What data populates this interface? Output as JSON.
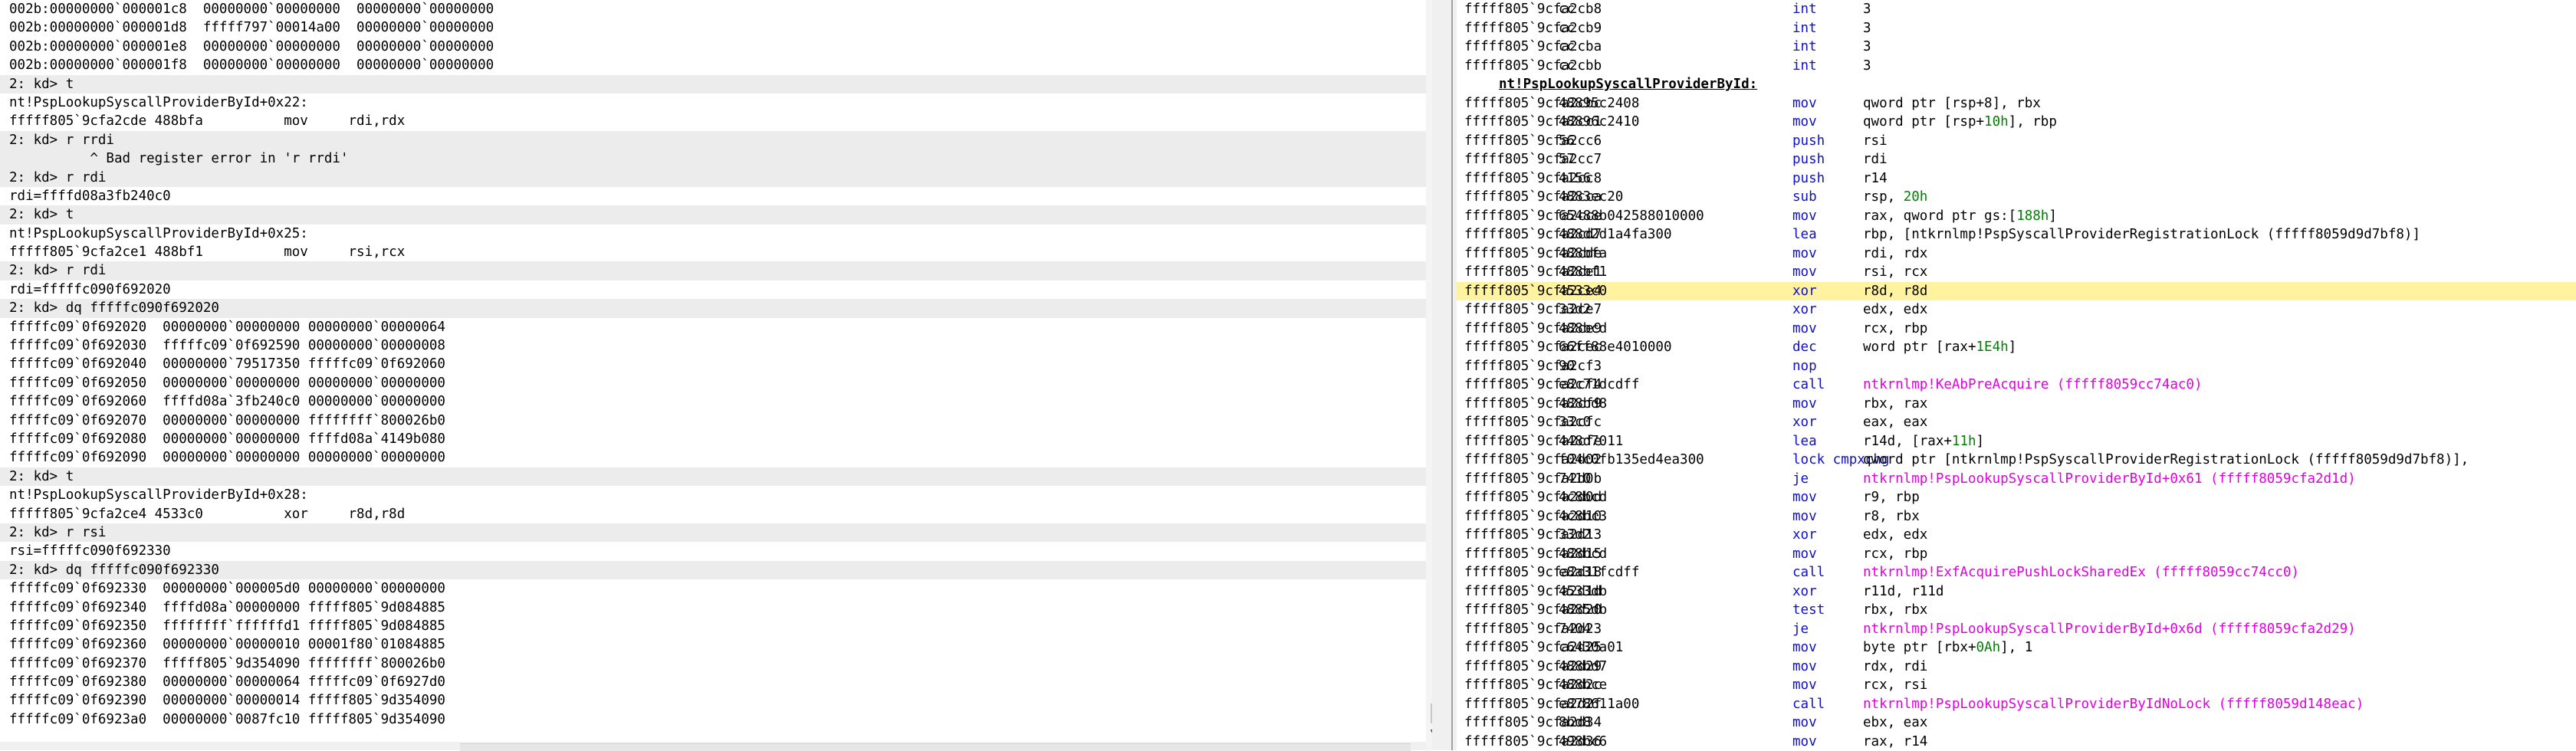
{
  "command_window": {
    "lines": [
      {
        "t": "002b:00000000`000001c8  00000000`00000000  00000000`00000000",
        "p": false
      },
      {
        "t": "002b:00000000`000001d8  fffff797`00014a00  00000000`00000000",
        "p": false
      },
      {
        "t": "002b:00000000`000001e8  00000000`00000000  00000000`00000000",
        "p": false
      },
      {
        "t": "002b:00000000`000001f8  00000000`00000000  00000000`00000000",
        "p": false
      },
      {
        "t": "2: kd> t",
        "p": true
      },
      {
        "t": "nt!PspLookupSyscallProviderById+0x22:",
        "p": false
      },
      {
        "t": "fffff805`9cfa2cde 488bfa          mov     rdi,rdx",
        "p": false
      },
      {
        "t": "2: kd> r rrdi",
        "p": true
      },
      {
        "t": "          ^ Bad register error in 'r rrdi'",
        "p": true
      },
      {
        "t": "2: kd> r rdi",
        "p": true
      },
      {
        "t": "rdi=ffffd08a3fb240c0",
        "p": false
      },
      {
        "t": "2: kd> t",
        "p": true
      },
      {
        "t": "nt!PspLookupSyscallProviderById+0x25:",
        "p": false
      },
      {
        "t": "fffff805`9cfa2ce1 488bf1          mov     rsi,rcx",
        "p": false
      },
      {
        "t": "2: kd> r rdi",
        "p": true
      },
      {
        "t": "rdi=fffffc090f692020",
        "p": false
      },
      {
        "t": "2: kd> dq fffffc090f692020",
        "p": true
      },
      {
        "t": "fffffc09`0f692020  00000000`00000000 00000000`00000064",
        "p": false
      },
      {
        "t": "fffffc09`0f692030  fffffc09`0f692590 00000000`00000008",
        "p": false
      },
      {
        "t": "fffffc09`0f692040  00000000`79517350 fffffc09`0f692060",
        "p": false
      },
      {
        "t": "fffffc09`0f692050  00000000`00000000 00000000`00000000",
        "p": false
      },
      {
        "t": "fffffc09`0f692060  ffffd08a`3fb240c0 00000000`00000000",
        "p": false
      },
      {
        "t": "fffffc09`0f692070  00000000`00000000 ffffffff`800026b0",
        "p": false
      },
      {
        "t": "fffffc09`0f692080  00000000`00000000 ffffd08a`4149b080",
        "p": false
      },
      {
        "t": "fffffc09`0f692090  00000000`00000000 00000000`00000000",
        "p": false
      },
      {
        "t": "2: kd> t",
        "p": true
      },
      {
        "t": "nt!PspLookupSyscallProviderById+0x28:",
        "p": false
      },
      {
        "t": "fffff805`9cfa2ce4 4533c0          xor     r8d,r8d",
        "p": false
      },
      {
        "t": "2: kd> r rsi",
        "p": true
      },
      {
        "t": "rsi=fffffc090f692330",
        "p": false
      },
      {
        "t": "2: kd> dq fffffc090f692330",
        "p": true
      },
      {
        "t": "fffffc09`0f692330  00000000`000005d0 00000000`00000000",
        "p": false
      },
      {
        "t": "fffffc09`0f692340  ffffd08a`00000000 fffff805`9d084885",
        "p": false
      },
      {
        "t": "fffffc09`0f692350  ffffffff`ffffffd1 fffff805`9d084885",
        "p": false
      },
      {
        "t": "fffffc09`0f692360  00000000`00000010 00001f80`01084885",
        "p": false
      },
      {
        "t": "fffffc09`0f692370  fffff805`9d354090 ffffffff`800026b0",
        "p": false
      },
      {
        "t": "fffffc09`0f692380  00000000`00000064 fffffc09`0f6927d0",
        "p": false
      },
      {
        "t": "fffffc09`0f692390  00000000`00000014 fffff805`9d354090",
        "p": false
      },
      {
        "t": "fffffc09`0f6923a0  00000000`0087fc10 fffff805`9d354090",
        "p": false
      }
    ]
  },
  "disassembly": {
    "rows": [
      {
        "addr": "fffff805`9cfa2cb8",
        "bytes": "cc",
        "mn": "int",
        "ops": [
          [
            "3",
            "n"
          ]
        ]
      },
      {
        "addr": "fffff805`9cfa2cb9",
        "bytes": "cc",
        "mn": "int",
        "ops": [
          [
            "3",
            "n"
          ]
        ]
      },
      {
        "addr": "fffff805`9cfa2cba",
        "bytes": "cc",
        "mn": "int",
        "ops": [
          [
            "3",
            "n"
          ]
        ]
      },
      {
        "addr": "fffff805`9cfa2cbb",
        "bytes": "cc",
        "mn": "int",
        "ops": [
          [
            "3",
            "n"
          ]
        ]
      },
      {
        "symbol": "nt!PspLookupSyscallProviderById:"
      },
      {
        "addr": "fffff805`9cfa2cbc",
        "bytes": "48895c2408",
        "mn": "mov",
        "ops": [
          [
            "qword ptr [rsp+8], rbx",
            "n"
          ]
        ]
      },
      {
        "addr": "fffff805`9cfa2cc1",
        "bytes": "48896c2410",
        "mn": "mov",
        "ops": [
          [
            "qword ptr [rsp+",
            "n"
          ],
          [
            "10h",
            "g"
          ],
          [
            "], rbp",
            "n"
          ]
        ]
      },
      {
        "addr": "fffff805`9cfa2cc6",
        "bytes": "56",
        "mn": "push",
        "ops": [
          [
            "rsi",
            "n"
          ]
        ]
      },
      {
        "addr": "fffff805`9cfa2cc7",
        "bytes": "57",
        "mn": "push",
        "ops": [
          [
            "rdi",
            "n"
          ]
        ]
      },
      {
        "addr": "fffff805`9cfa2cc8",
        "bytes": "4156",
        "mn": "push",
        "ops": [
          [
            "r14",
            "n"
          ]
        ]
      },
      {
        "addr": "fffff805`9cfa2cca",
        "bytes": "4883ec20",
        "mn": "sub",
        "ops": [
          [
            "rsp, ",
            "n"
          ],
          [
            "20h",
            "g"
          ]
        ]
      },
      {
        "addr": "fffff805`9cfa2cce",
        "bytes": "65488b042588010000",
        "mn": "mov",
        "ops": [
          [
            "rax, qword ptr gs:[",
            "n"
          ],
          [
            "188h",
            "g"
          ],
          [
            "]",
            "n"
          ]
        ]
      },
      {
        "addr": "fffff805`9cfa2cd7",
        "bytes": "488d2d1a4fa300",
        "mn": "lea",
        "ops": [
          [
            "rbp, [ntkrnlmp!PspSyscallProviderRegistrationLock (fffff8059d9d7bf8)]",
            "n"
          ]
        ]
      },
      {
        "addr": "fffff805`9cfa2cde",
        "bytes": "488bfa",
        "mn": "mov",
        "ops": [
          [
            "rdi, rdx",
            "n"
          ]
        ]
      },
      {
        "addr": "fffff805`9cfa2ce1",
        "bytes": "488bf1",
        "mn": "mov",
        "ops": [
          [
            "rsi, rcx",
            "n"
          ]
        ]
      },
      {
        "addr": "fffff805`9cfa2ce4",
        "bytes": "4533c0",
        "mn": "xor",
        "ops": [
          [
            "r8d, r8d",
            "n"
          ]
        ],
        "hl": true
      },
      {
        "addr": "fffff805`9cfa2ce7",
        "bytes": "33d2",
        "mn": "xor",
        "ops": [
          [
            "edx, edx",
            "n"
          ]
        ]
      },
      {
        "addr": "fffff805`9cfa2ce9",
        "bytes": "488bcd",
        "mn": "mov",
        "ops": [
          [
            "rcx, rbp",
            "n"
          ]
        ]
      },
      {
        "addr": "fffff805`9cfa2cec",
        "bytes": "66ff88e4010000",
        "mn": "dec",
        "ops": [
          [
            "word ptr [rax+",
            "n"
          ],
          [
            "1E4h",
            "g"
          ],
          [
            "]",
            "n"
          ]
        ]
      },
      {
        "addr": "fffff805`9cfa2cf3",
        "bytes": "90",
        "mn": "nop",
        "ops": []
      },
      {
        "addr": "fffff805`9cfa2cf4",
        "bytes": "e8c71dcdff",
        "mn": "call",
        "ops": [
          [
            "ntkrnlmp!KeAbPreAcquire (fffff8059cc74ac0)",
            "s"
          ]
        ]
      },
      {
        "addr": "fffff805`9cfa2cf9",
        "bytes": "488bd8",
        "mn": "mov",
        "ops": [
          [
            "rbx, rax",
            "n"
          ]
        ]
      },
      {
        "addr": "fffff805`9cfa2cfc",
        "bytes": "33c0",
        "mn": "xor",
        "ops": [
          [
            "eax, eax",
            "n"
          ]
        ]
      },
      {
        "addr": "fffff805`9cfa2cfe",
        "bytes": "448d7011",
        "mn": "lea",
        "ops": [
          [
            "r14d, [rax+",
            "n"
          ],
          [
            "11h",
            "g"
          ],
          [
            "]",
            "n"
          ]
        ]
      },
      {
        "addr": "fffff805`9cfa2d02",
        "bytes": "f04c0fb135ed4ea300",
        "mn": "lock cmpxchg",
        "ops": [
          [
            "qword ptr [ntkrnlmp!PspSyscallProviderRegistrationLock (fffff8059d9d7bf8)], ",
            "n"
          ]
        ]
      },
      {
        "addr": "fffff805`9cfa2d0b",
        "bytes": "7410",
        "mn": "je",
        "ops": [
          [
            "ntkrnlmp!PspLookupSyscallProviderById+0x61 (fffff8059cfa2d1d)",
            "s"
          ]
        ]
      },
      {
        "addr": "fffff805`9cfa2d0d",
        "bytes": "4c8bcd",
        "mn": "mov",
        "ops": [
          [
            "r9, rbp",
            "n"
          ]
        ]
      },
      {
        "addr": "fffff805`9cfa2d10",
        "bytes": "4c8bc3",
        "mn": "mov",
        "ops": [
          [
            "r8, rbx",
            "n"
          ]
        ]
      },
      {
        "addr": "fffff805`9cfa2d13",
        "bytes": "33d2",
        "mn": "xor",
        "ops": [
          [
            "edx, edx",
            "n"
          ]
        ]
      },
      {
        "addr": "fffff805`9cfa2d15",
        "bytes": "488bcd",
        "mn": "mov",
        "ops": [
          [
            "rcx, rbp",
            "n"
          ]
        ]
      },
      {
        "addr": "fffff805`9cfa2d18",
        "bytes": "e8a31fcdff",
        "mn": "call",
        "ops": [
          [
            "ntkrnlmp!ExfAcquirePushLockSharedEx (fffff8059cc74cc0)",
            "s"
          ]
        ]
      },
      {
        "addr": "fffff805`9cfa2d1d",
        "bytes": "4533db",
        "mn": "xor",
        "ops": [
          [
            "r11d, r11d",
            "n"
          ]
        ]
      },
      {
        "addr": "fffff805`9cfa2d20",
        "bytes": "4885db",
        "mn": "test",
        "ops": [
          [
            "rbx, rbx",
            "n"
          ]
        ]
      },
      {
        "addr": "fffff805`9cfa2d23",
        "bytes": "7404",
        "mn": "je",
        "ops": [
          [
            "ntkrnlmp!PspLookupSyscallProviderById+0x6d (fffff8059cfa2d29)",
            "s"
          ]
        ]
      },
      {
        "addr": "fffff805`9cfa2d25",
        "bytes": "c6430a01",
        "mn": "mov",
        "ops": [
          [
            "byte ptr [rbx+",
            "n"
          ],
          [
            "0Ah",
            "g"
          ],
          [
            "], 1",
            "n"
          ]
        ]
      },
      {
        "addr": "fffff805`9cfa2d29",
        "bytes": "488bd7",
        "mn": "mov",
        "ops": [
          [
            "rdx, rdi",
            "n"
          ]
        ]
      },
      {
        "addr": "fffff805`9cfa2d2c",
        "bytes": "488bce",
        "mn": "mov",
        "ops": [
          [
            "rcx, rsi",
            "n"
          ]
        ]
      },
      {
        "addr": "fffff805`9cfa2d2f",
        "bytes": "e878611a00",
        "mn": "call",
        "ops": [
          [
            "ntkrnlmp!PspLookupSyscallProviderByIdNoLock (fffff8059d148eac)",
            "s"
          ]
        ]
      },
      {
        "addr": "fffff805`9cfa2d34",
        "bytes": "8bd8",
        "mn": "mov",
        "ops": [
          [
            "ebx, eax",
            "n"
          ]
        ]
      },
      {
        "addr": "fffff805`9cfa2d36",
        "bytes": "498bc6",
        "mn": "mov",
        "ops": [
          [
            "rax, r14",
            "n"
          ]
        ]
      }
    ]
  },
  "scrollbar": {
    "down_arrow": "▼"
  },
  "colors": {
    "prompt_bg": "#ececec",
    "highlight": "#fff3a0",
    "mnemonic": "#1010c0",
    "number": "#008000",
    "symbol": "#e000e0"
  }
}
